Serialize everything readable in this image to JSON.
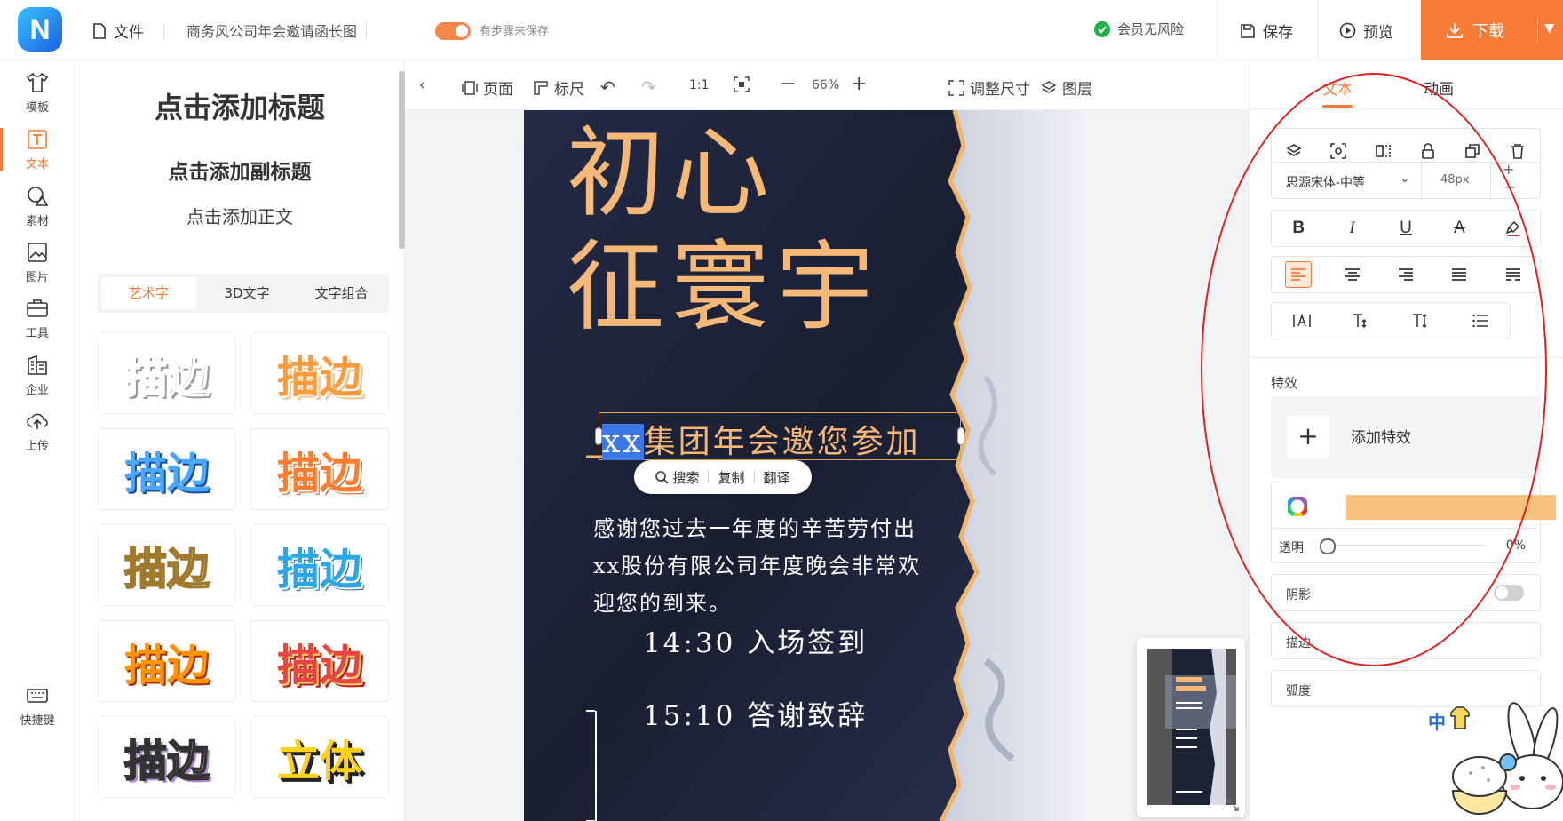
{
  "topbar": {
    "logo_letter": "N",
    "file_label": "文件",
    "doc_title": "商务风公司年会邀请函长图",
    "unsaved_label": "有步骤未保存",
    "member_label": "会员无风险",
    "save_label": "保存",
    "preview_label": "预览",
    "download_label": "下载",
    "accent_color": "#f57b37"
  },
  "leftnav": {
    "items": [
      {
        "label": "模板",
        "icon": "tshirt-icon"
      },
      {
        "label": "文本",
        "icon": "text-icon"
      },
      {
        "label": "素材",
        "icon": "shapes-icon"
      },
      {
        "label": "图片",
        "icon": "image-icon"
      },
      {
        "label": "工具",
        "icon": "toolbox-icon"
      },
      {
        "label": "企业",
        "icon": "building-icon"
      },
      {
        "label": "上传",
        "icon": "upload-icon"
      }
    ],
    "shortcut_label": "快捷键",
    "active_index": 1
  },
  "textpanel": {
    "add_title": "点击添加标题",
    "add_subtitle": "点击添加副标题",
    "add_body": "点击添加正文",
    "tabs": [
      "艺术字",
      "3D文字",
      "文字组合"
    ],
    "samples": [
      "描边",
      "描边",
      "描边",
      "描边",
      "描边",
      "描边",
      "描边",
      "描边",
      "描边",
      "立体"
    ]
  },
  "canvas_toolbar": {
    "page_label": "页面",
    "ruler_label": "标尺",
    "ratio_label": "1:1",
    "zoom": "66%",
    "resize_label": "调整尺寸",
    "layers_label": "图层"
  },
  "poster": {
    "line1": "初心",
    "line2": "征寰宇",
    "invite_highlight": "xx",
    "invite_rest": "集团年会邀您参加",
    "popup": [
      "搜索",
      "复制",
      "翻译"
    ],
    "body_lines": [
      "感谢您过去一年度的辛苦劳付出",
      "xx股份有限公司年度晚会非常欢",
      "迎您的到来。"
    ],
    "schedule": [
      "14:30 入场签到",
      "15:10 答谢致辞"
    ]
  },
  "right_panel": {
    "tabs": [
      "文本",
      "动画"
    ],
    "font_name": "思源宋体-中等",
    "font_size": "48px",
    "effects_label": "特效",
    "add_effect_label": "添加特效",
    "fill_color": "#f8c17e",
    "opacity_label": "透明",
    "opacity_value": "0%",
    "shadow_label": "阴影",
    "stroke_label": "描边",
    "arc_label": "弧度"
  }
}
